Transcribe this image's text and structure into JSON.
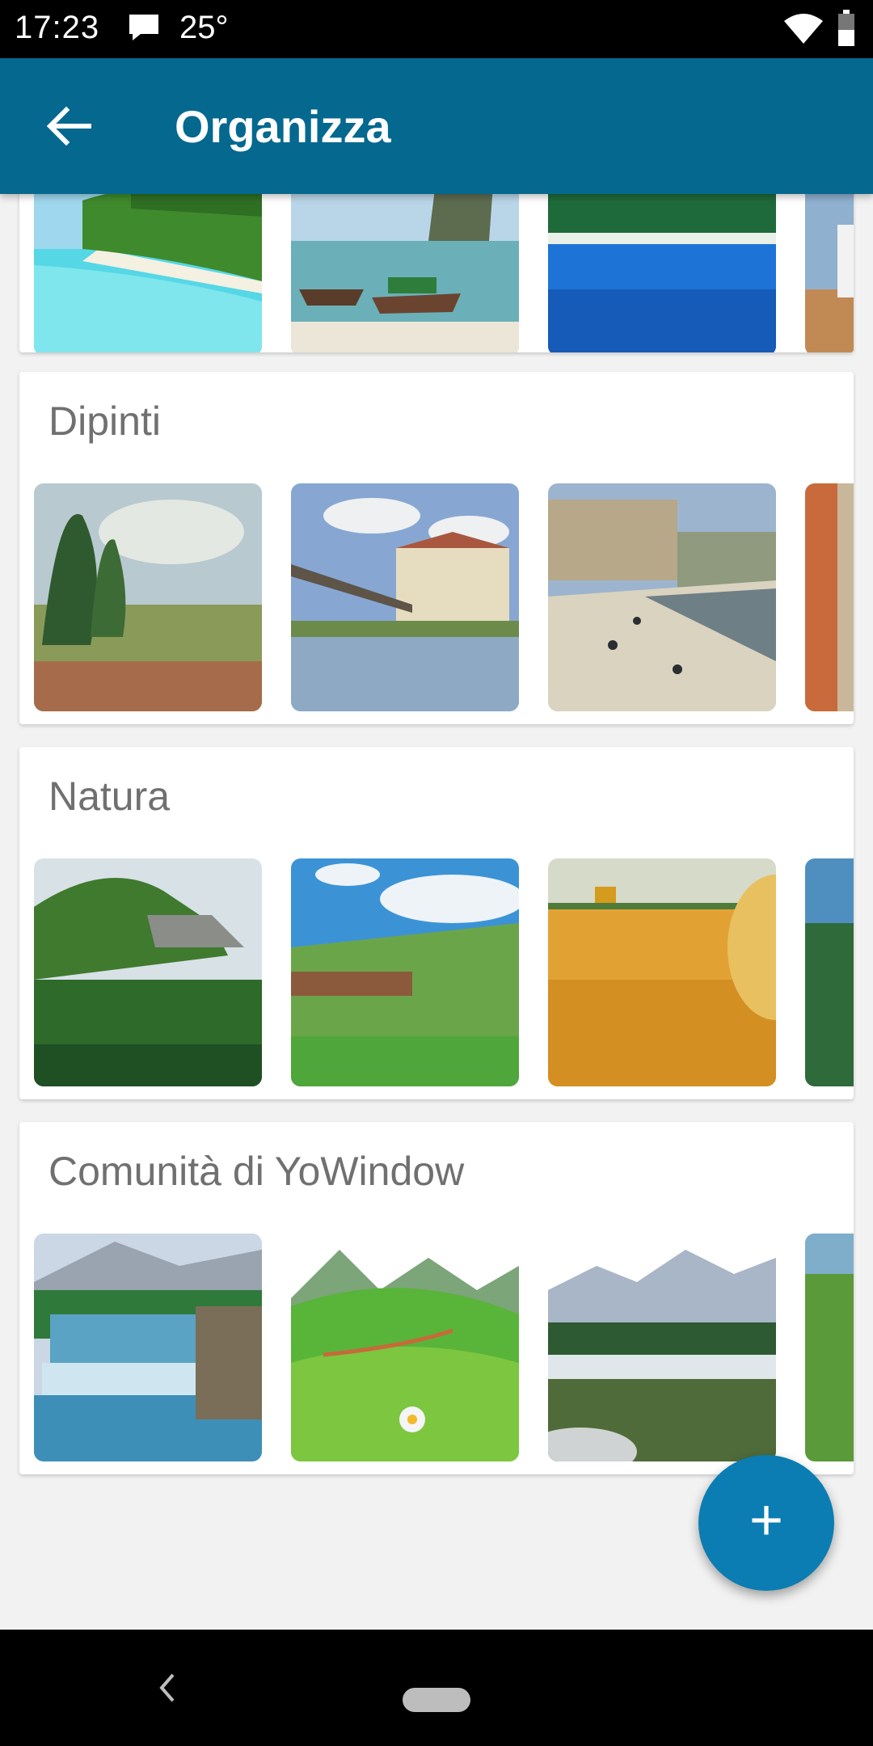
{
  "status": {
    "time": "17:23",
    "temperature": "25°"
  },
  "appbar": {
    "title": "Organizza"
  },
  "sections": [
    {
      "title": "Dipinti"
    },
    {
      "title": "Natura"
    },
    {
      "title": "Comunità di YoWindow"
    }
  ],
  "fab": {
    "label": "+"
  },
  "colors": {
    "appbar": "#05688f",
    "fab": "#0b7db2"
  }
}
